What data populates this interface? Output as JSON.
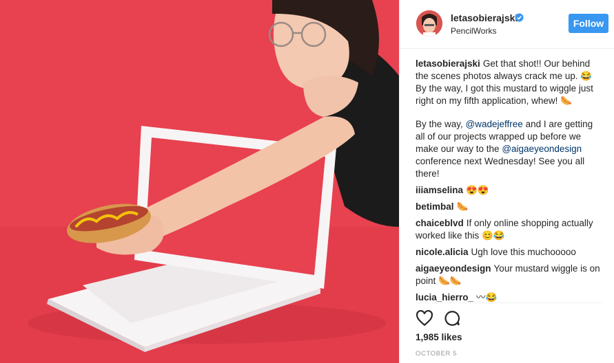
{
  "header": {
    "username": "letasobierajski",
    "location": "PencilWorks",
    "follow_label": "Follow"
  },
  "caption": {
    "username": "letasobierajski",
    "text1": "Get that shot!! Our behind the scenes photos always crack me up. 😂 By the way, I got this mustard to wiggle just right on my fifth application, whew! 🌭",
    "text2_a": "By the way,",
    "mention1": "@wadejeffree",
    "text2_b": "and I are getting all of our projects wrapped up before we make our way to the",
    "mention2": "@aigaeyeondesign",
    "text2_c": "conference next Wednesday! See you all there!"
  },
  "comments": [
    {
      "user": "iiiamselina",
      "text": "😍😍"
    },
    {
      "user": "betimbal",
      "text": "🌭"
    },
    {
      "user": "chaiceblvd",
      "text": "If only online shopping actually worked like this 😊😂"
    },
    {
      "user": "nicole.alicia",
      "text": "Ugh love this muchooooo"
    },
    {
      "user": "aigaeyeondesign",
      "text": "Your mustard wiggle is on point 🌭🌭"
    },
    {
      "user": "lucia_hierro_",
      "text": "〰😂"
    }
  ],
  "actions": {
    "like_icon": "heart-icon",
    "comment_icon": "comment-bubble-icon"
  },
  "likes": "1,985 likes",
  "date": "OCTOBER 5",
  "colors": {
    "photo_background": "#e8414f",
    "follow_button": "#3897f0",
    "verified_badge": "#3897f0",
    "mention": "#003569"
  }
}
